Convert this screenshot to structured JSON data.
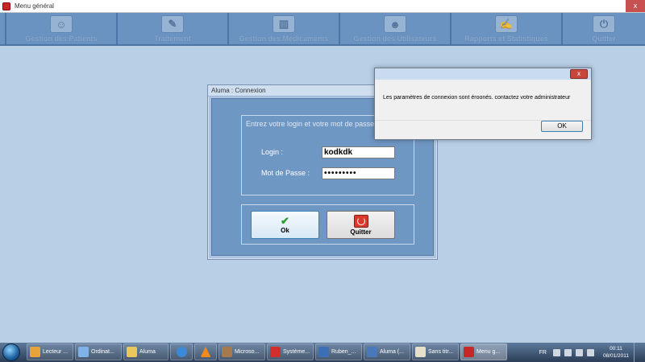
{
  "main_window": {
    "title": "Menu général",
    "close_label": "x"
  },
  "toolbar": {
    "items": [
      {
        "label": "Gestion des Patients",
        "icon": "patient-icon"
      },
      {
        "label": "Traitement",
        "icon": "syringe-icon"
      },
      {
        "label": "Gestion des Médicaments",
        "icon": "medicine-icon"
      },
      {
        "label": "Gestion des Utilisateurs",
        "icon": "users-icon"
      },
      {
        "label": "Rapports et Statistiques",
        "icon": "report-icon"
      },
      {
        "label": "Quitter",
        "icon": "power-icon"
      }
    ]
  },
  "login": {
    "title": "Aluma : Connexion",
    "prompt": "Entrez votre login et votre mot de passe",
    "login_label": "Login :",
    "login_value": "kodkdk",
    "password_label": "Mot de Passe :",
    "password_value": "•••••••••",
    "ok_label": "Ok",
    "quit_label": "Quitter"
  },
  "message_box": {
    "close_label": "x",
    "text": "Les paramètres de connexion sont éroonés. contactez votre administrateur",
    "ok_label": "OK"
  },
  "taskbar": {
    "items": [
      {
        "label": "Lecteur ...",
        "icon": "media-player-icon",
        "color": "#e8a33a"
      },
      {
        "label": "Ordinat...",
        "icon": "computer-icon",
        "color": "#7fb2e6"
      },
      {
        "label": "Aluma",
        "icon": "folder-icon",
        "color": "#e9c75a"
      },
      {
        "label": "",
        "icon": "internet-explorer-icon",
        "color": "#3b8ad8"
      },
      {
        "label": "",
        "icon": "vlc-icon",
        "color": "#f08a1c"
      },
      {
        "label": "Microso...",
        "icon": "tools-icon",
        "color": "#a57a4f"
      },
      {
        "label": "Système...",
        "icon": "antivirus-icon",
        "color": "#d42d2d"
      },
      {
        "label": "Ruben_...",
        "icon": "word-document-icon",
        "color": "#3c6fb5"
      },
      {
        "label": "Aluma (...",
        "icon": "visual-studio-icon",
        "color": "#4a79b8"
      },
      {
        "label": "Sans titr...",
        "icon": "paint-icon",
        "color": "#e6e0c8"
      },
      {
        "label": "Menu g...",
        "icon": "app-icon",
        "color": "#c62828"
      }
    ],
    "lang": "FR",
    "time": "00:11",
    "date": "08/01/2011"
  }
}
